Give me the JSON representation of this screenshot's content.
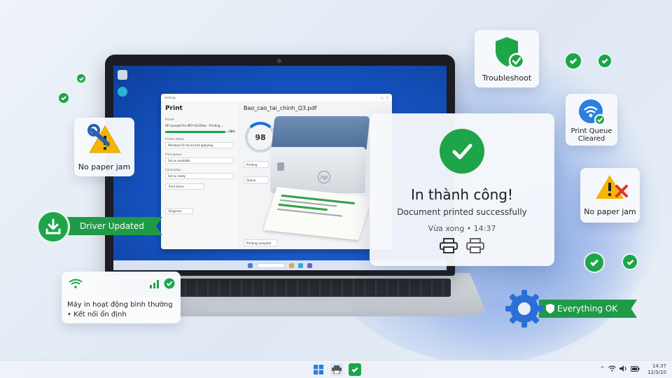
{
  "print_dialog": {
    "window_title": "Settings",
    "heading": "Print",
    "printer_label": "Printer",
    "printer_value": "HP LaserJet Pro MFP 4102fdw – Printing...",
    "progress_percent": 98,
    "progress_text": "98%",
    "section_1_label": "Printer status",
    "section_1_value": "Windows fix found and applying",
    "section_2_label": "Print queue",
    "section_2_value": "Set as available",
    "section_3_label": "Connection",
    "section_3_value": "Set as ready",
    "print_button": "Print driver",
    "footer_button": "Diagnose",
    "file_name": "Bao_cao_tai_chinh_Q3.pdf",
    "ring_value": "98",
    "chip_1": "Printing",
    "chip_2": "Queue",
    "chip_3": "Printing complete"
  },
  "success": {
    "title": "In thành công!",
    "subtitle": "Document printed successfully",
    "time": "Vừa xong • 14:37"
  },
  "cards": {
    "troubleshoot": "Troubleshoot",
    "print_queue_line1": "Print Queue",
    "print_queue_line2": "Cleared",
    "no_paper_jam_left": "No paper jam",
    "no_paper_jam_right": "No paper jam",
    "driver_updated": "Driver Updated",
    "everything_ok": "Everything OK"
  },
  "status_card": {
    "line1": "Máy in hoạt động bình thường",
    "line2": "• Kết nối ổn định"
  },
  "printer": {
    "brand": "hp"
  },
  "os": {
    "clock_time": "14:37",
    "clock_date": "12/3/10"
  },
  "colors": {
    "accent_green": "#1ea54a",
    "ribbon_green": "#1f9a47",
    "windows_blue": "#1757c8",
    "warning_yellow": "#f5b400",
    "error_red": "#e0352b"
  }
}
